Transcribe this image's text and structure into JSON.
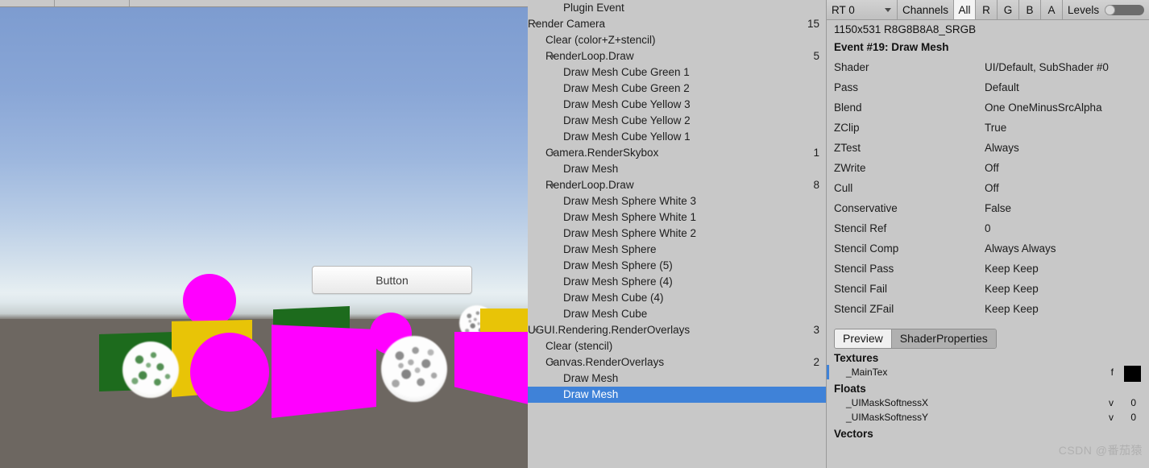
{
  "scene": {
    "ui_button_label": "Button",
    "sky_top_color": "#7d9cd0",
    "ground_color": "#6d6761",
    "magenta": "#ff00ff",
    "yellow": "#e8c407",
    "green": "#1d6b1d"
  },
  "tree": {
    "rows": [
      {
        "depth": 2,
        "arrow": "",
        "label": "Plugin Event",
        "count": ""
      },
      {
        "depth": 0,
        "arrow": "▼",
        "label": "Render Camera",
        "count": "15"
      },
      {
        "depth": 1,
        "arrow": "",
        "label": "Clear (color+Z+stencil)",
        "count": ""
      },
      {
        "depth": 1,
        "arrow": "▼",
        "label": "RenderLoop.Draw",
        "count": "5"
      },
      {
        "depth": 2,
        "arrow": "",
        "label": "Draw Mesh Cube Green 1",
        "count": ""
      },
      {
        "depth": 2,
        "arrow": "",
        "label": "Draw Mesh Cube Green 2",
        "count": ""
      },
      {
        "depth": 2,
        "arrow": "",
        "label": "Draw Mesh Cube Yellow 3",
        "count": ""
      },
      {
        "depth": 2,
        "arrow": "",
        "label": "Draw Mesh Cube Yellow 2",
        "count": ""
      },
      {
        "depth": 2,
        "arrow": "",
        "label": "Draw Mesh Cube Yellow 1",
        "count": ""
      },
      {
        "depth": 1,
        "arrow": "▼",
        "label": "Camera.RenderSkybox",
        "count": "1"
      },
      {
        "depth": 2,
        "arrow": "",
        "label": "Draw Mesh",
        "count": ""
      },
      {
        "depth": 1,
        "arrow": "▼",
        "label": "RenderLoop.Draw",
        "count": "8"
      },
      {
        "depth": 2,
        "arrow": "",
        "label": "Draw Mesh Sphere White 3",
        "count": ""
      },
      {
        "depth": 2,
        "arrow": "",
        "label": "Draw Mesh Sphere White 1",
        "count": ""
      },
      {
        "depth": 2,
        "arrow": "",
        "label": "Draw Mesh Sphere White 2",
        "count": ""
      },
      {
        "depth": 2,
        "arrow": "",
        "label": "Draw Mesh Sphere",
        "count": ""
      },
      {
        "depth": 2,
        "arrow": "",
        "label": "Draw Mesh Sphere (5)",
        "count": ""
      },
      {
        "depth": 2,
        "arrow": "",
        "label": "Draw Mesh Sphere (4)",
        "count": ""
      },
      {
        "depth": 2,
        "arrow": "",
        "label": "Draw Mesh Cube (4)",
        "count": ""
      },
      {
        "depth": 2,
        "arrow": "",
        "label": "Draw Mesh Cube",
        "count": ""
      },
      {
        "depth": 0,
        "arrow": "▼",
        "label": "UGUI.Rendering.RenderOverlays",
        "count": "3"
      },
      {
        "depth": 1,
        "arrow": "",
        "label": "Clear (stencil)",
        "count": ""
      },
      {
        "depth": 1,
        "arrow": "▼",
        "label": "Canvas.RenderOverlays",
        "count": "2"
      },
      {
        "depth": 2,
        "arrow": "",
        "label": "Draw Mesh",
        "count": ""
      },
      {
        "depth": 2,
        "arrow": "",
        "label": "Draw Mesh",
        "count": "",
        "selected": true
      }
    ]
  },
  "inspector": {
    "toolbar": {
      "rt_selector": "RT 0",
      "channels_label": "Channels",
      "channel_all": "All",
      "channel_r": "R",
      "channel_g": "G",
      "channel_b": "B",
      "channel_a": "A",
      "levels_label": "Levels"
    },
    "rt_info": "1150x531 R8G8B8A8_SRGB",
    "event_title": "Event #19: Draw Mesh",
    "properties": [
      {
        "key": "Shader",
        "value": "UI/Default, SubShader #0"
      },
      {
        "key": "Pass",
        "value": "Default"
      },
      {
        "key": "Blend",
        "value": "One OneMinusSrcAlpha"
      },
      {
        "key": "ZClip",
        "value": "True"
      },
      {
        "key": "ZTest",
        "value": "Always"
      },
      {
        "key": "ZWrite",
        "value": "Off"
      },
      {
        "key": "Cull",
        "value": "Off"
      },
      {
        "key": "Conservative",
        "value": "False"
      },
      {
        "key": "Stencil Ref",
        "value": "0"
      },
      {
        "key": "Stencil Comp",
        "value": "Always Always"
      },
      {
        "key": "Stencil Pass",
        "value": "Keep Keep"
      },
      {
        "key": "Stencil Fail",
        "value": "Keep Keep"
      },
      {
        "key": "Stencil ZFail",
        "value": "Keep Keep"
      }
    ],
    "tabs": [
      {
        "label": "Preview",
        "active": true
      },
      {
        "label": "ShaderProperties",
        "active": false
      }
    ],
    "shader_properties": {
      "textures_header": "Textures",
      "textures": [
        {
          "name": "_MainTex",
          "flag": "f",
          "value": "",
          "swatch": "#000000"
        }
      ],
      "floats_header": "Floats",
      "floats": [
        {
          "name": "_UIMaskSoftnessX",
          "flag": "v",
          "value": "0"
        },
        {
          "name": "_UIMaskSoftnessY",
          "flag": "v",
          "value": "0"
        }
      ],
      "vectors_header": "Vectors"
    },
    "watermark": "CSDN @番茄猿"
  }
}
